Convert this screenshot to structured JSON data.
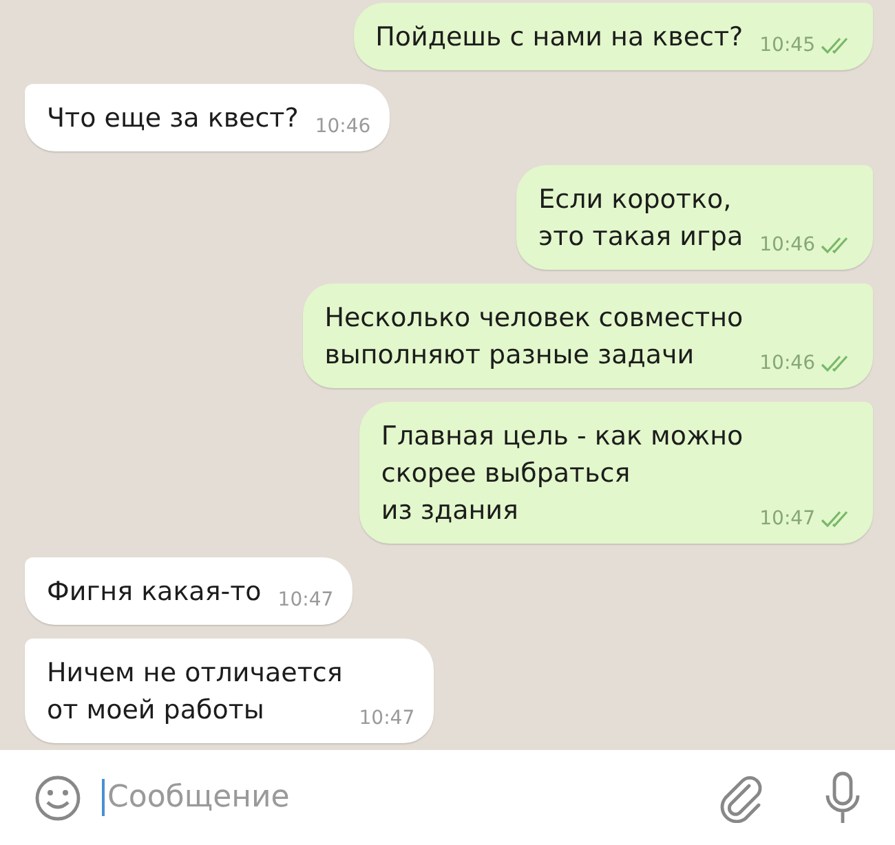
{
  "messages": [
    {
      "kind": "outgoing",
      "text": "Пойдешь с нами на квест?",
      "time": "10:45",
      "read": true
    },
    {
      "kind": "incoming",
      "text": "Что еще за квест?",
      "time": "10:46"
    },
    {
      "kind": "outgoing",
      "text": "Если коротко,\nэто такая игра",
      "time": "10:46",
      "read": true
    },
    {
      "kind": "outgoing",
      "text": "Несколько человек совместно\nвыполняют разные задачи",
      "time": "10:46",
      "read": true
    },
    {
      "kind": "outgoing",
      "text": "Главная цель - как можно\nскорее выбраться\nиз здания",
      "time": "10:47",
      "read": true
    },
    {
      "kind": "incoming",
      "text": "Фигня какая-то",
      "time": "10:47"
    },
    {
      "kind": "incoming",
      "text": "Ничем не отличается\nот моей работы",
      "time": "10:47"
    }
  ],
  "composer": {
    "placeholder": "Сообщение"
  }
}
